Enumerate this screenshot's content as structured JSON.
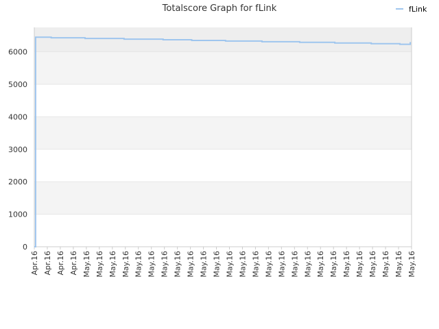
{
  "chart_data": {
    "type": "line",
    "title": "Totalscore Graph for fLink",
    "legend": {
      "placement": "top-right",
      "entries": [
        "fLink"
      ]
    },
    "colors": {
      "series": "#9ec5ee",
      "band_dark": "#eeeeee",
      "band_light": "#f4f4f4",
      "grid": "#e6e6e6",
      "axis": "#cccccc",
      "text": "#333333"
    },
    "grid": true,
    "ylim": [
      0,
      6750
    ],
    "yticks": [
      0,
      1000,
      2000,
      3000,
      4000,
      5000,
      6000
    ],
    "xticks": [
      "Apr.16",
      "Apr.16",
      "Apr.16",
      "Apr.16",
      "May.16",
      "May.16",
      "May.16",
      "May.16",
      "May.16",
      "May.16",
      "May.16",
      "May.16",
      "May.16",
      "May.16",
      "May.16",
      "May.16",
      "May.16",
      "May.16",
      "May.16",
      "May.16",
      "May.16",
      "May.16",
      "May.16",
      "May.16",
      "May.16",
      "May.16",
      "May.16",
      "May.16",
      "May.16",
      "May.16"
    ],
    "series": [
      {
        "name": "fLink",
        "x": [
          0,
          0.1,
          1.3,
          3.9,
          6.9,
          9.9,
          12.1,
          14.7,
          17.5,
          20.4,
          23.1,
          25.9,
          28.1,
          28.9
        ],
        "y": [
          0,
          6450,
          6430,
          6410,
          6390,
          6370,
          6350,
          6330,
          6310,
          6290,
          6270,
          6250,
          6230,
          6300
        ]
      }
    ]
  }
}
